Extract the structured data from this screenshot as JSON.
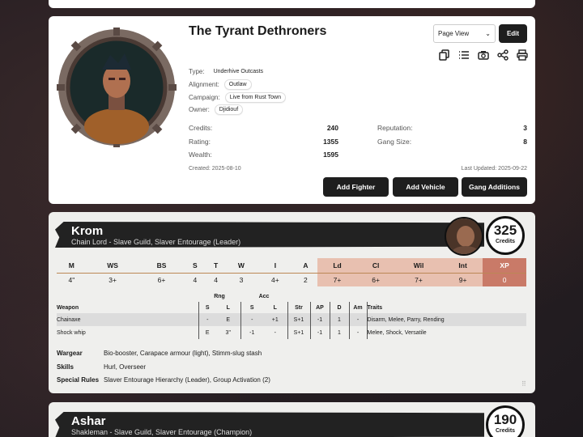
{
  "gang": {
    "title": "The Tyrant Dethroners",
    "type_label": "Type:",
    "type": "Underhive Outcasts",
    "alignment_label": "Alignment:",
    "alignment": "Outlaw",
    "campaign_label": "Campaign:",
    "campaign": "Live from Rust Town",
    "owner_label": "Owner:",
    "owner": "Djidiouf",
    "credits_label": "Credits:",
    "credits": "240",
    "rating_label": "Rating:",
    "rating": "1355",
    "wealth_label": "Wealth:",
    "wealth": "1595",
    "reputation_label": "Reputation:",
    "reputation": "3",
    "gangsize_label": "Gang Size:",
    "gangsize": "8",
    "created": "Created: 2025-08-10",
    "updated": "Last Updated: 2025-09-22",
    "view_select": "Page View",
    "edit": "Edit",
    "add_fighter": "Add Fighter",
    "add_vehicle": "Add Vehicle",
    "gang_additions": "Gang Additions"
  },
  "icons": [
    "copy-icon",
    "list-icon",
    "camera-icon",
    "share-icon",
    "print-icon"
  ],
  "fighter1": {
    "name": "Krom",
    "subtitle": "Chain Lord - Slave Guild, Slaver Entourage (Leader)",
    "credits": "325",
    "credits_label": "Credits",
    "stat_headers": [
      "M",
      "WS",
      "BS",
      "S",
      "T",
      "W",
      "I",
      "A",
      "Ld",
      "Cl",
      "Wil",
      "Int",
      "XP"
    ],
    "stat_values": [
      "4\"",
      "3+",
      "6+",
      "4",
      "4",
      "3",
      "4+",
      "2",
      "7+",
      "6+",
      "7+",
      "9+",
      "0"
    ],
    "rng": "Rng",
    "acc": "Acc",
    "weapon_headers": [
      "Weapon",
      "S",
      "L",
      "S",
      "L",
      "Str",
      "AP",
      "D",
      "Am",
      "Traits"
    ],
    "weapons": [
      [
        "Chainaxe",
        "-",
        "E",
        "-",
        "+1",
        "S+1",
        "-1",
        "1",
        "-",
        "Disarm, Melee, Parry, Rending"
      ],
      [
        "Shock whip",
        "E",
        "3\"",
        "-1",
        "-",
        "S+1",
        "-1",
        "1",
        "-",
        "Melee, Shock, Versatile"
      ]
    ],
    "wargear_label": "Wargear",
    "wargear": "Bio-booster, Carapace armour (light), Stimm-slug stash",
    "skills_label": "Skills",
    "skills": "Hurl, Overseer",
    "rules_label": "Special Rules",
    "rules": "Slaver Entourage Hierarchy (Leader), Group Activation (2)"
  },
  "fighter2": {
    "name": "Ashar",
    "subtitle": "Shakleman - Slave Guild, Slaver Entourage (Champion)",
    "credits": "190",
    "credits_label": "Credits"
  }
}
